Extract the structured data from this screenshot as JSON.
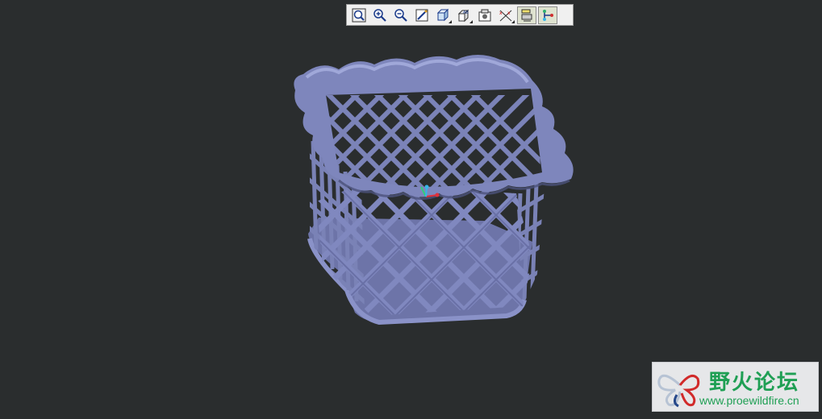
{
  "toolbar": {
    "buttons": [
      {
        "name": "zoom-fit-icon"
      },
      {
        "name": "zoom-in-icon"
      },
      {
        "name": "zoom-out-icon"
      },
      {
        "name": "repaint-icon"
      },
      {
        "name": "display-style-icon"
      },
      {
        "name": "saved-views-icon"
      },
      {
        "name": "view-manager-icon"
      },
      {
        "name": "datum-display-icon"
      },
      {
        "name": "annotation-display-icon"
      },
      {
        "name": "csys-display-icon"
      }
    ]
  },
  "model": {
    "name": "wire-basket",
    "color": "#7b83b8",
    "highlight": "#a9b0e0",
    "shadow": "#4c527c"
  },
  "triad": {
    "x_color": "#e0303a",
    "y_color": "#2fd07a",
    "z_color": "#37b7e8"
  },
  "watermark": {
    "title": "野火论坛",
    "url": "www.proewildfire.cn",
    "color": "#1f9f54"
  }
}
